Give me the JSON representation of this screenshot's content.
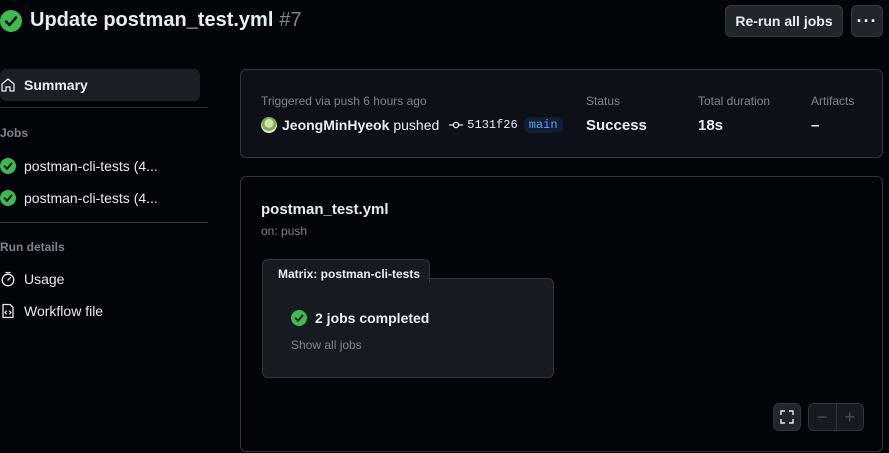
{
  "header": {
    "title": "Update postman_test.yml",
    "run_number": "#7",
    "rerun_label": "Re-run all jobs",
    "more_label": "···"
  },
  "sidebar": {
    "summary_label": "Summary",
    "jobs_heading": "Jobs",
    "jobs": [
      {
        "label": "postman-cli-tests (4..."
      },
      {
        "label": "postman-cli-tests (4..."
      }
    ],
    "run_details_heading": "Run details",
    "usage_label": "Usage",
    "workflow_file_label": "Workflow file"
  },
  "summary": {
    "trigger_text": "Triggered via push 6 hours ago",
    "actor": "JeongMinHyeok",
    "action": "pushed",
    "commit": "5131f26",
    "branch": "main",
    "status_label": "Status",
    "status_value": "Success",
    "duration_label": "Total duration",
    "duration_value": "18s",
    "artifacts_label": "Artifacts",
    "artifacts_value": "–"
  },
  "graph": {
    "workflow_name": "postman_test.yml",
    "trigger": "on: push",
    "matrix_label": "Matrix: postman-cli-tests",
    "jobs_completed": "2 jobs completed",
    "show_all": "Show all jobs",
    "zoom_out": "−",
    "zoom_in": "+"
  },
  "colors": {
    "success": "#3fb950",
    "background": "#010409",
    "border": "#30363d",
    "link": "#58a6ff"
  }
}
